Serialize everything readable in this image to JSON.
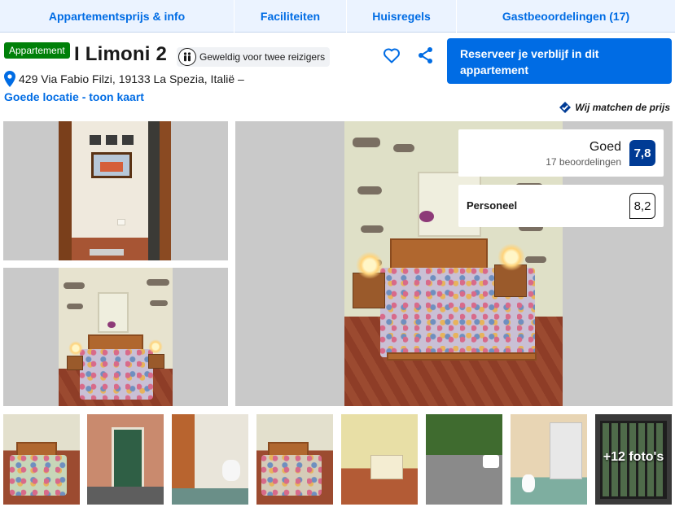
{
  "tabs": [
    {
      "label": "Appartementsprijs & info"
    },
    {
      "label": "Faciliteiten"
    },
    {
      "label": "Huisregels"
    },
    {
      "label": "Gastbeoordelingen (17)"
    }
  ],
  "property": {
    "type_badge": "Appartement",
    "name": "I Limoni 2",
    "pill_text": "Geweldig voor twee reizigers",
    "address": "429 Via Fabio Filzi, 19133 La Spezia, Italië –",
    "location_link": "Goede locatie - toon kaart",
    "reserve_label": "Reserveer je verblijf in dit appartement",
    "price_match": "Wij matchen de prijs"
  },
  "rating": {
    "word": "Goed",
    "count": "17 beoordelingen",
    "score": "7,8"
  },
  "staff": {
    "label": "Personeel",
    "score": "8,2"
  },
  "gallery": {
    "more_photos": "+12 foto's"
  },
  "icons": {
    "heart": "heart-icon",
    "share": "share-icon",
    "pin": "location-pin-icon",
    "travellers": "two-travellers-icon",
    "check": "check-shield-icon"
  },
  "colors": {
    "brand_blue": "#006ce4",
    "dark_blue": "#003b95",
    "green_badge": "#008009",
    "tab_bg": "#ebf3ff"
  }
}
